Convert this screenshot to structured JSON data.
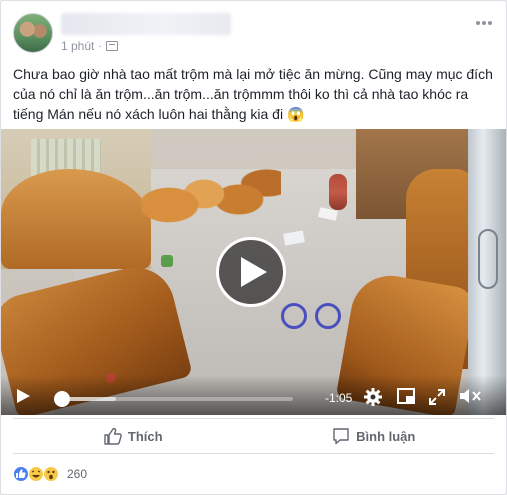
{
  "post": {
    "timestamp": "1 phút",
    "text": "Chưa bao giờ nhà tao mất trộm mà lại mở tiệc ăn mừng. Cũng may mục đích của nó chỉ là ăn trộm...ăn trộm...ăn trộmmm thôi ko thì cả nhà tao khóc ra tiếng Mán nếu nó xách luôn hai thằng kia đi 😱"
  },
  "video": {
    "time_remaining": "-1:05",
    "progress": 0.02,
    "buffered": 0.25
  },
  "actions": {
    "like_label": "Thích",
    "comment_label": "Bình luận"
  },
  "reactions": {
    "types": [
      "like-icon",
      "haha-icon",
      "wow-icon"
    ],
    "count": "260"
  },
  "colors": {
    "accent": "#4a7ef0",
    "text_secondary": "#606770"
  }
}
